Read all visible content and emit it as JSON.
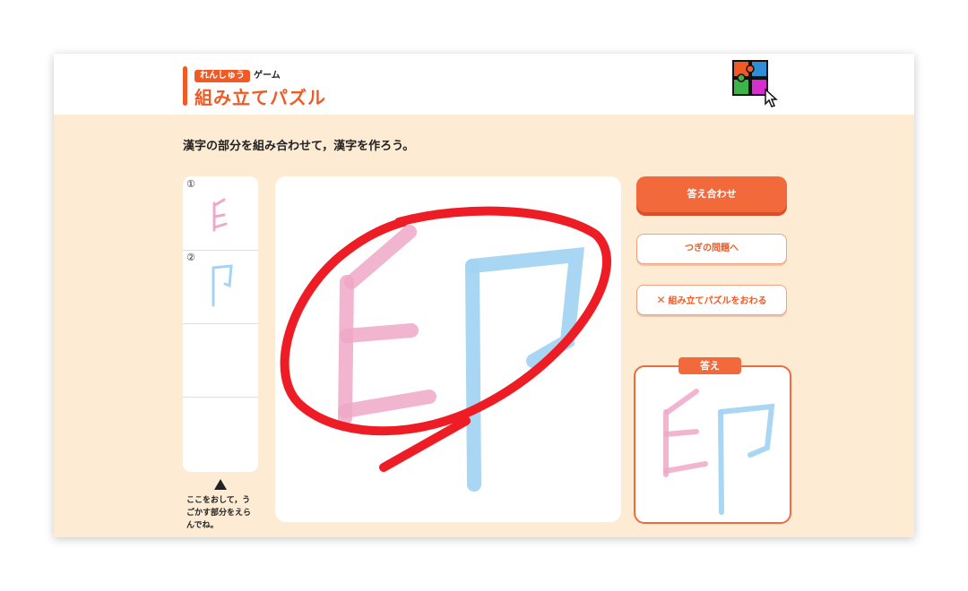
{
  "header": {
    "badge_label": "れんしゅう",
    "subtitle": "ゲーム",
    "title": "組み立てパズル",
    "logo_icon": "puzzle-logo-icon"
  },
  "instruction": "漢字の部分を組み合わせて，漢字を作ろう。",
  "parts_panel": {
    "slots": [
      {
        "number": "①",
        "glyph": "pink-left-part-icon"
      },
      {
        "number": "②",
        "glyph": "blue-right-part-icon"
      },
      {
        "number": "",
        "glyph": ""
      },
      {
        "number": "",
        "glyph": ""
      }
    ],
    "scroll_icon": "triangle-up-icon",
    "hint": "ここをおして，うごかす部分をえらんでね。"
  },
  "buttons": {
    "check_answer": "答え合わせ",
    "next_question": "つぎの問題へ",
    "quit": "組み立てパズルをおわる",
    "quit_icon": "close-icon"
  },
  "answer_panel": {
    "label": "答え"
  },
  "colors": {
    "accent": "#f15a24",
    "background": "#fdebd4",
    "part_pink": "#f0a8c8",
    "part_blue": "#a3d4f2",
    "annotation_red": "#ee1c24"
  }
}
